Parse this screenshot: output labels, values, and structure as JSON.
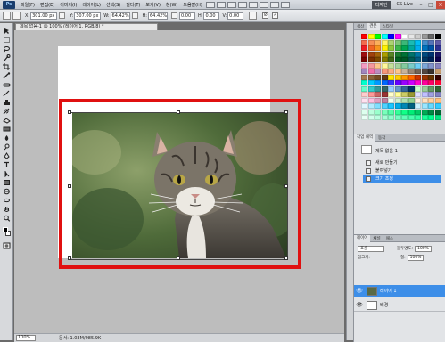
{
  "menubar": {
    "logo": "Ps",
    "items": [
      "파일(F)",
      "편집(E)",
      "이미지(I)",
      "레이어(L)",
      "선택(S)",
      "필터(T)",
      "보기(V)",
      "창(W)",
      "도움말(H)"
    ],
    "design_label": "디자인",
    "cslive_label": "CS Live"
  },
  "options": {
    "x_label": "X:",
    "x_value": "301.00 px",
    "y_label": "Y:",
    "y_value": "307.00 px",
    "w_label": "W:",
    "w_value": "64.42%",
    "h_label": "H:",
    "h_value": "64.42%",
    "angle_value": "0.00",
    "h_skew_label": "H:",
    "h_skew_value": "0.00",
    "v_skew_label": "V:",
    "v_skew_value": "0.00"
  },
  "document": {
    "tab_title": "제목 없음-1 @ 100% (레이어 1, RGB/8) *",
    "zoom": "100%",
    "doc_info": "문서: 1.03M/985.9K"
  },
  "swatches": {
    "tabs": [
      "색상",
      "견본",
      "스타일"
    ],
    "colors": [
      "#ff0000",
      "#ffff00",
      "#00ff00",
      "#00ffff",
      "#0000ff",
      "#ff00ff",
      "#ffffff",
      "#e6e6e6",
      "#cccccc",
      "#999999",
      "#666666",
      "#000000",
      "#f26c4f",
      "#f68e55",
      "#fbaf5c",
      "#fff467",
      "#acd372",
      "#7cc576",
      "#3bb878",
      "#1abbb4",
      "#00bff3",
      "#438cca",
      "#5574b9",
      "#605ca8",
      "#ed1c24",
      "#f26522",
      "#f7941d",
      "#fff200",
      "#8dc63f",
      "#39b54a",
      "#00a651",
      "#00a99d",
      "#00aeef",
      "#0072bc",
      "#0054a6",
      "#2e3192",
      "#9e0b0f",
      "#a0410d",
      "#a36209",
      "#aba000",
      "#598527",
      "#197b30",
      "#007236",
      "#00746b",
      "#0076a3",
      "#004b80",
      "#003471",
      "#1b1464",
      "#790000",
      "#7b2e00",
      "#7d4900",
      "#827b00",
      "#406618",
      "#005e20",
      "#005826",
      "#005952",
      "#005b7f",
      "#003663",
      "#002157",
      "#0d004c",
      "#f49ac2",
      "#f5989d",
      "#fdc68a",
      "#fff79a",
      "#c4df9b",
      "#a3d39c",
      "#82ca9d",
      "#7accc8",
      "#6dcff6",
      "#7da7d9",
      "#8393ca",
      "#8781bd",
      "#a186be",
      "#f06eaa",
      "#bd8cbf",
      "#f7977a",
      "#f9ad81",
      "#fdc68a",
      "#c7b299",
      "#998675",
      "#736357",
      "#534741",
      "#37302d",
      "#c69c6d",
      "#a67c52",
      "#8c6239",
      "#754c24",
      "#603913",
      "#ffe600",
      "#ffcc00",
      "#ff9900",
      "#ff6600",
      "#cc3300",
      "#993300",
      "#663300",
      "#330000",
      "#00ffcc",
      "#00ccff",
      "#0099ff",
      "#0066ff",
      "#3333ff",
      "#6600ff",
      "#9900ff",
      "#cc00ff",
      "#ff00cc",
      "#ff0099",
      "#ff0066",
      "#ff0033",
      "#66ffcc",
      "#33cccc",
      "#339999",
      "#336666",
      "#99ccff",
      "#6699cc",
      "#336699",
      "#003366",
      "#ccffcc",
      "#99cc99",
      "#669966",
      "#336633",
      "#ffcccc",
      "#ff9999",
      "#cc6666",
      "#993333",
      "#ffffcc",
      "#ffff99",
      "#cccc66",
      "#999933",
      "#e0e0ff",
      "#c0c0ff",
      "#a0a0e0",
      "#8080c0",
      "#ffe0f0",
      "#ffc0e0",
      "#e0a0c0",
      "#c080a0",
      "#f0fff0",
      "#d0f0d0",
      "#b0e0b0",
      "#90d090",
      "#fff0e0",
      "#ffe0c0",
      "#ffd0a0",
      "#ffc080",
      "#e0f7ff",
      "#b3ecff",
      "#80dfff",
      "#4dd2ff",
      "#1ac6ff",
      "#00ace6",
      "#0086b3",
      "#006080",
      "#ccf2ff",
      "#99e6ff",
      "#66d9ff",
      "#33ccff",
      "#ddffee",
      "#bbffdd",
      "#99ffcc",
      "#77ffbb",
      "#55ffaa",
      "#33ff99",
      "#11ff88",
      "#00ee77",
      "#00cc66",
      "#00aa55",
      "#008844",
      "#006633",
      "#e8fff5",
      "#d1ffeb",
      "#baffe0",
      "#a3ffd6",
      "#8cffcc",
      "#75ffc2",
      "#5effb8",
      "#47ffad",
      "#30ffa3",
      "#19ff99",
      "#00ff8f",
      "#00e680"
    ]
  },
  "history": {
    "tabs": [
      "작업 내역",
      "동작"
    ],
    "title": "제목 없음-1",
    "items": [
      "새로 만들기",
      "붙여넣기",
      "크기 조정"
    ]
  },
  "layers": {
    "tabs": [
      "레이어",
      "채널",
      "패스"
    ],
    "blend_mode": "표준",
    "opacity_label": "불투명도:",
    "opacity_value": "100%",
    "lock_label": "잠그기:",
    "fill_label": "칠:",
    "fill_value": "100%",
    "items": [
      {
        "name": "레이어 1"
      },
      {
        "name": "배경"
      }
    ]
  }
}
